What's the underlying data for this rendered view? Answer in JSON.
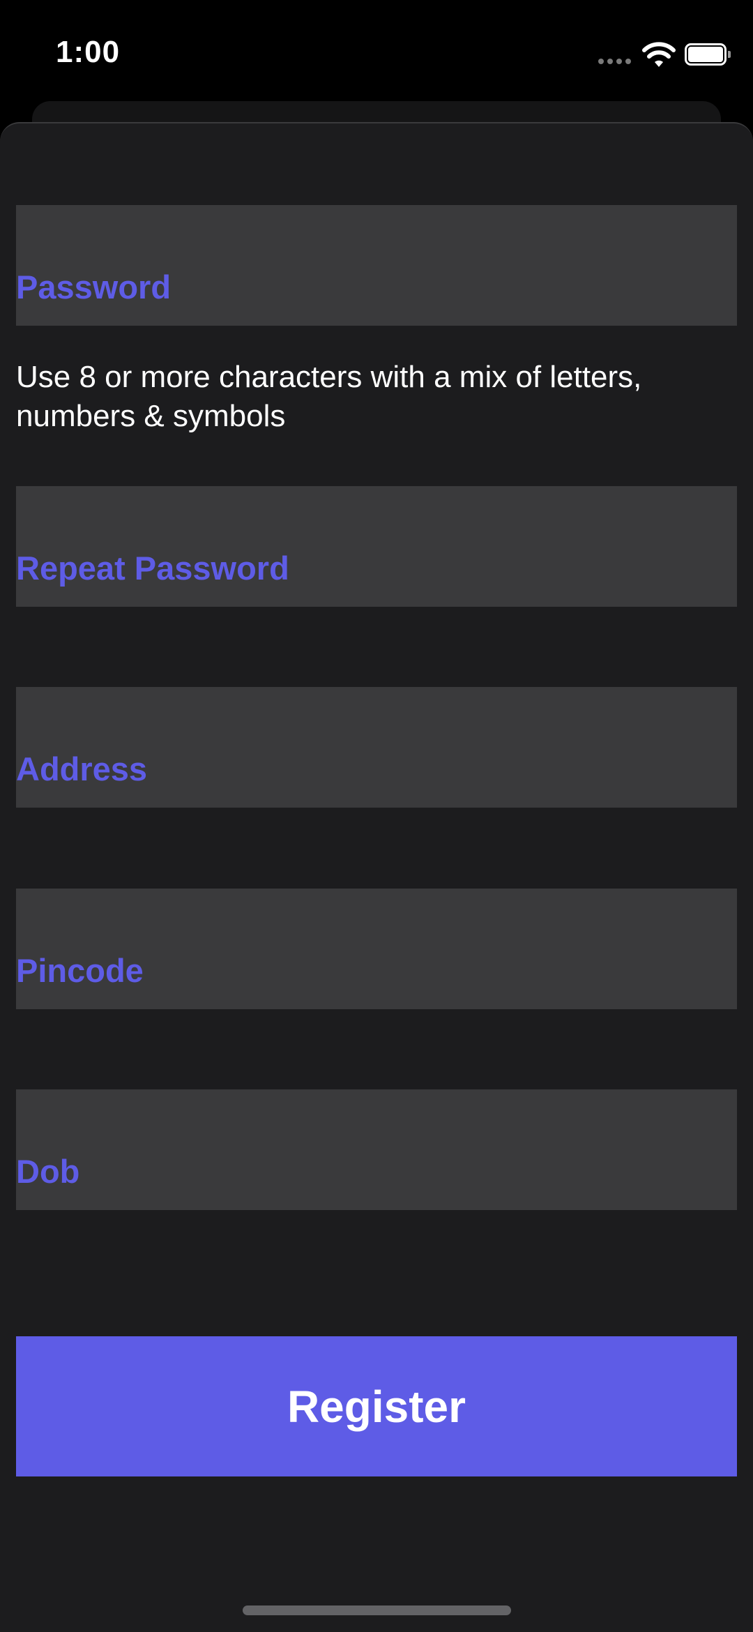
{
  "status_bar": {
    "time": "1:00",
    "icons": [
      "cellular-signal-icon",
      "wifi-icon",
      "battery-icon"
    ]
  },
  "form": {
    "fields": [
      {
        "label": "Password"
      },
      {
        "label": "Repeat Password"
      },
      {
        "label": "Address"
      },
      {
        "label": "Pincode"
      },
      {
        "label": "Dob"
      }
    ],
    "password_hint": "Use 8 or more characters with a mix of letters, numbers & symbols",
    "submit_label": "Register"
  },
  "colors": {
    "accent": "#5e5ce6",
    "sheet_background": "#1c1c1e",
    "field_background": "#3a3a3c",
    "screen_background": "#000000"
  }
}
